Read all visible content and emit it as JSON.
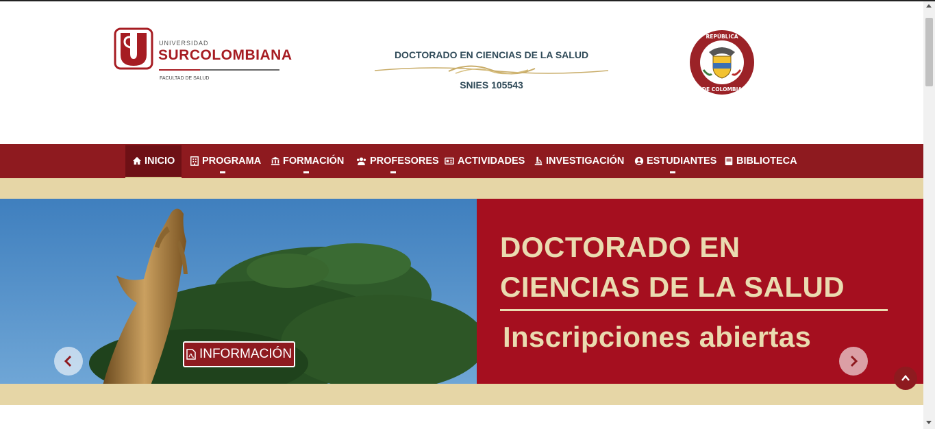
{
  "header": {
    "university_small": "UNIVERSIDAD",
    "university_big": "SURCOLOMBIANA",
    "faculty": "FACULTAD DE SALUD",
    "program_name": "DOCTORADO EN CIENCIAS DE LA SALUD",
    "snies": "SNIES 105543"
  },
  "nav": {
    "items": [
      {
        "label": "INICIO",
        "icon": "home-icon"
      },
      {
        "label": "PROGRAMA",
        "icon": "building-icon"
      },
      {
        "label": "FORMACIÓN",
        "icon": "institution-icon"
      },
      {
        "label": "PROFESORES",
        "icon": "users-icon"
      },
      {
        "label": "ACTIVIDADES",
        "icon": "id-card-icon"
      },
      {
        "label": "INVESTIGACIÓN",
        "icon": "microscope-icon"
      },
      {
        "label": "ESTUDIANTES",
        "icon": "user-circle-icon"
      },
      {
        "label": "BIBLIOTECA",
        "icon": "book-icon"
      }
    ]
  },
  "hero": {
    "title_line1": "DOCTORADO EN",
    "title_line2": "CIENCIAS DE LA SALUD",
    "subtitle": "Inscripciones abiertas",
    "button_label": "INFORMACIÓN"
  },
  "colors": {
    "brand_red": "#8e1a1f",
    "hero_red": "#a50f1f",
    "beige": "#e6d6a6",
    "title_blue": "#2f4a58"
  }
}
